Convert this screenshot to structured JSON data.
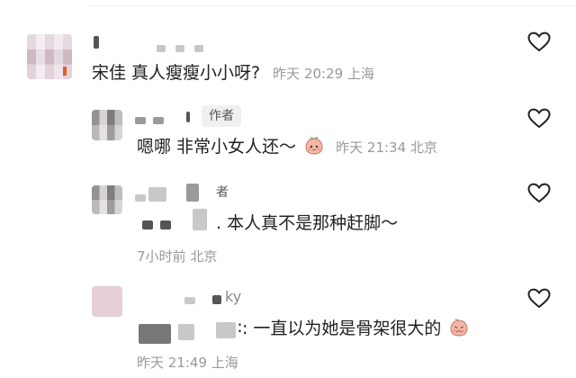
{
  "comments": [
    {
      "text": "宋佳  真人瘦瘦小小呀?",
      "time": "昨天 20:29",
      "location": "上海"
    },
    {
      "author_tag": "作者",
      "text": "嗯哪  非常小女人还～",
      "emoji": "peach-face-emoji",
      "time": "昨天 21:34",
      "location": "北京"
    },
    {
      "author_tag_partial": "者",
      "text": ". 本人真不是那种赶脚～",
      "time": "7小时前",
      "location": "北京"
    },
    {
      "handle_suffix": "ky",
      "text": "∶: 一直以为她是骨架很大的",
      "emoji": "peach-worried-emoji",
      "time": "昨天 21:49",
      "location": "上海"
    }
  ],
  "icons": {
    "like": "heart-outline-icon"
  },
  "colors": {
    "text": "#222222",
    "meta": "#999999",
    "tag_bg": "#f0f0f0",
    "peach": "#f3b7a7"
  }
}
